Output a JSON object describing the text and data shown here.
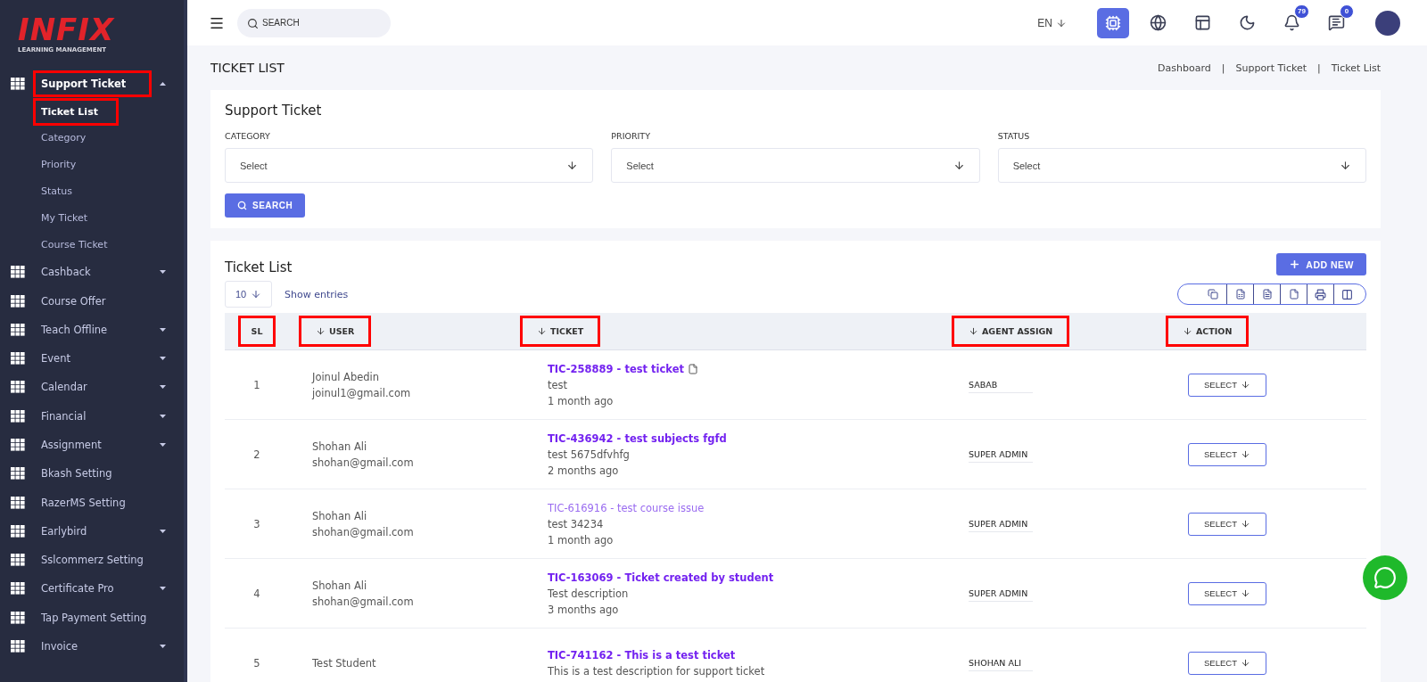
{
  "sidebar": {
    "logo": {
      "title": "INFIX",
      "subtitle": "LEARNING MANAGEMENT"
    },
    "items": [
      {
        "label": "Support Ticket",
        "expandable": true,
        "expanded": true,
        "highlighted": true,
        "children": [
          {
            "label": "Ticket List",
            "selected": true,
            "highlighted": true
          },
          {
            "label": "Category",
            "selected": false,
            "highlighted": false
          },
          {
            "label": "Priority",
            "selected": false,
            "highlighted": false
          },
          {
            "label": "Status",
            "selected": false,
            "highlighted": false
          },
          {
            "label": "My Ticket",
            "selected": false,
            "highlighted": false
          },
          {
            "label": "Course Ticket",
            "selected": false,
            "highlighted": false
          }
        ]
      },
      {
        "label": "Cashback",
        "expandable": true,
        "expanded": false,
        "highlighted": false
      },
      {
        "label": "Course Offer",
        "expandable": false,
        "expanded": false,
        "highlighted": false
      },
      {
        "label": "Teach Offline",
        "expandable": true,
        "expanded": false,
        "highlighted": false
      },
      {
        "label": "Event",
        "expandable": true,
        "expanded": false,
        "highlighted": false
      },
      {
        "label": "Calendar",
        "expandable": true,
        "expanded": false,
        "highlighted": false
      },
      {
        "label": "Financial",
        "expandable": true,
        "expanded": false,
        "highlighted": false
      },
      {
        "label": "Assignment",
        "expandable": true,
        "expanded": false,
        "highlighted": false
      },
      {
        "label": "Bkash Setting",
        "expandable": false,
        "expanded": false,
        "highlighted": false
      },
      {
        "label": "RazerMS Setting",
        "expandable": false,
        "expanded": false,
        "highlighted": false
      },
      {
        "label": "Earlybird",
        "expandable": true,
        "expanded": false,
        "highlighted": false
      },
      {
        "label": "Sslcommerz Setting",
        "expandable": false,
        "expanded": false,
        "highlighted": false
      },
      {
        "label": "Certificate Pro",
        "expandable": true,
        "expanded": false,
        "highlighted": false
      },
      {
        "label": "Tap Payment Setting",
        "expandable": false,
        "expanded": false,
        "highlighted": false
      },
      {
        "label": "Invoice",
        "expandable": true,
        "expanded": false,
        "highlighted": false
      }
    ]
  },
  "topbar": {
    "search": {
      "placeholder": "SEARCH"
    },
    "language": "EN",
    "notifications": "79",
    "messages": "0"
  },
  "page": {
    "title": "TICKET LIST",
    "breadcrumb": [
      "Dashboard",
      "Support Ticket",
      "Ticket List"
    ],
    "breadcrumb_separator": "|"
  },
  "filter": {
    "title": "Support Ticket",
    "fields": [
      {
        "label": "CATEGORY",
        "value": "Select"
      },
      {
        "label": "PRIORITY",
        "value": "Select"
      },
      {
        "label": "STATUS",
        "value": "Select"
      }
    ],
    "button": "SEARCH"
  },
  "ticket_list": {
    "title": "Ticket List",
    "add_button": "ADD NEW",
    "page_size": "10",
    "page_size_label": "Show entries",
    "columns": [
      {
        "label": "SL",
        "sortable": false,
        "highlighted": true
      },
      {
        "label": "USER",
        "sortable": true,
        "highlighted": true
      },
      {
        "label": "TICKET",
        "sortable": true,
        "highlighted": true
      },
      {
        "label": "AGENT ASSIGN",
        "sortable": true,
        "highlighted": true
      },
      {
        "label": "ACTION",
        "sortable": true,
        "highlighted": true
      }
    ],
    "rows": [
      {
        "sl": "1",
        "name": "Joinul Abedin",
        "email": "joinul1@gmail.com",
        "ticket": "TIC-258889 - test ticket",
        "attachment": true,
        "visited": false,
        "description": "test",
        "time": "1 month ago",
        "agent": "SABAB",
        "action": "SELECT"
      },
      {
        "sl": "2",
        "name": "Shohan Ali",
        "email": "shohan@gmail.com",
        "ticket": "TIC-436942 - test subjects fgfd",
        "attachment": false,
        "visited": false,
        "description": "test 5675dfvhfg",
        "time": "2 months ago",
        "agent": "SUPER ADMIN",
        "action": "SELECT"
      },
      {
        "sl": "3",
        "name": "Shohan Ali",
        "email": "shohan@gmail.com",
        "ticket": "TIC-616916 - test course issue",
        "attachment": false,
        "visited": true,
        "description": "test 34234",
        "time": "1 month ago",
        "agent": "SUPER ADMIN",
        "action": "SELECT"
      },
      {
        "sl": "4",
        "name": "Shohan Ali",
        "email": "shohan@gmail.com",
        "ticket": "TIC-163069 - Ticket created by student",
        "attachment": false,
        "visited": false,
        "description": "Test description",
        "time": "3 months ago",
        "agent": "SUPER ADMIN",
        "action": "SELECT"
      },
      {
        "sl": "5",
        "name": "Test Student",
        "ticket": "TIC-741162 - This is a test ticket",
        "attachment": false,
        "visited": false,
        "description": "This is a test description for support ticket",
        "agent": "SHOHAN ALI",
        "action": "SELECT"
      }
    ]
  }
}
